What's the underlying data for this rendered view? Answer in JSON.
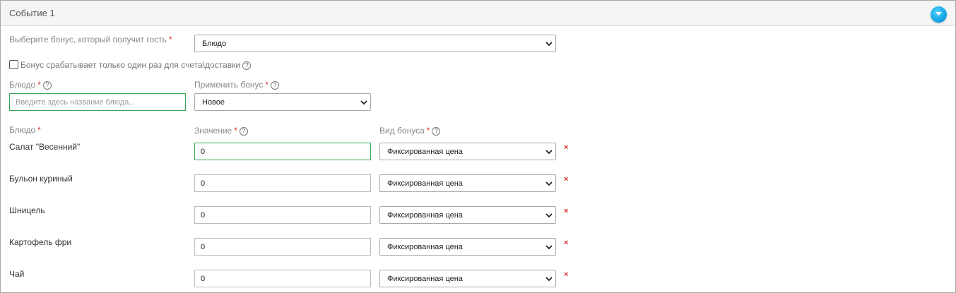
{
  "panel": {
    "title": "Событие 1",
    "toggle_icon": "chevron-down-icon"
  },
  "bonus_select": {
    "label": "Выберите бонус, который получит гость",
    "required_mark": "*",
    "value": "Блюдо"
  },
  "once_checkbox": {
    "label": "Бонус срабатывает только один раз для счета\\доставки",
    "checked": false,
    "help": "?"
  },
  "dish_search": {
    "label": "Блюдо",
    "required_mark": "*",
    "help": "?",
    "placeholder": "Введите здесь название блюда..."
  },
  "apply_bonus": {
    "label": "Применить бонус",
    "required_mark": "*",
    "help": "?",
    "value": "Новое"
  },
  "table": {
    "headers": {
      "dish": "Блюдо",
      "dish_required": "*",
      "value": "Значение",
      "value_required": "*",
      "value_help": "?",
      "bonus_type": "Вид бонуса",
      "bonus_type_required": "*",
      "bonus_type_help": "?"
    },
    "remove_icon": "×",
    "rows": [
      {
        "dish": "Салат \"Весенний\"",
        "value": "0",
        "bonus_type": "Фиксированная цена"
      },
      {
        "dish": "Бульон куриный",
        "value": "0",
        "bonus_type": "Фиксированная цена"
      },
      {
        "dish": "Шницель",
        "value": "0",
        "bonus_type": "Фиксированная цена"
      },
      {
        "dish": "Картофель фри",
        "value": "0",
        "bonus_type": "Фиксированная цена"
      },
      {
        "dish": "Чай",
        "value": "0",
        "bonus_type": "Фиксированная цена"
      }
    ]
  },
  "colors": {
    "accent": "#0a9fe0",
    "required": "#d9302c",
    "focus_border": "#3aa655"
  }
}
